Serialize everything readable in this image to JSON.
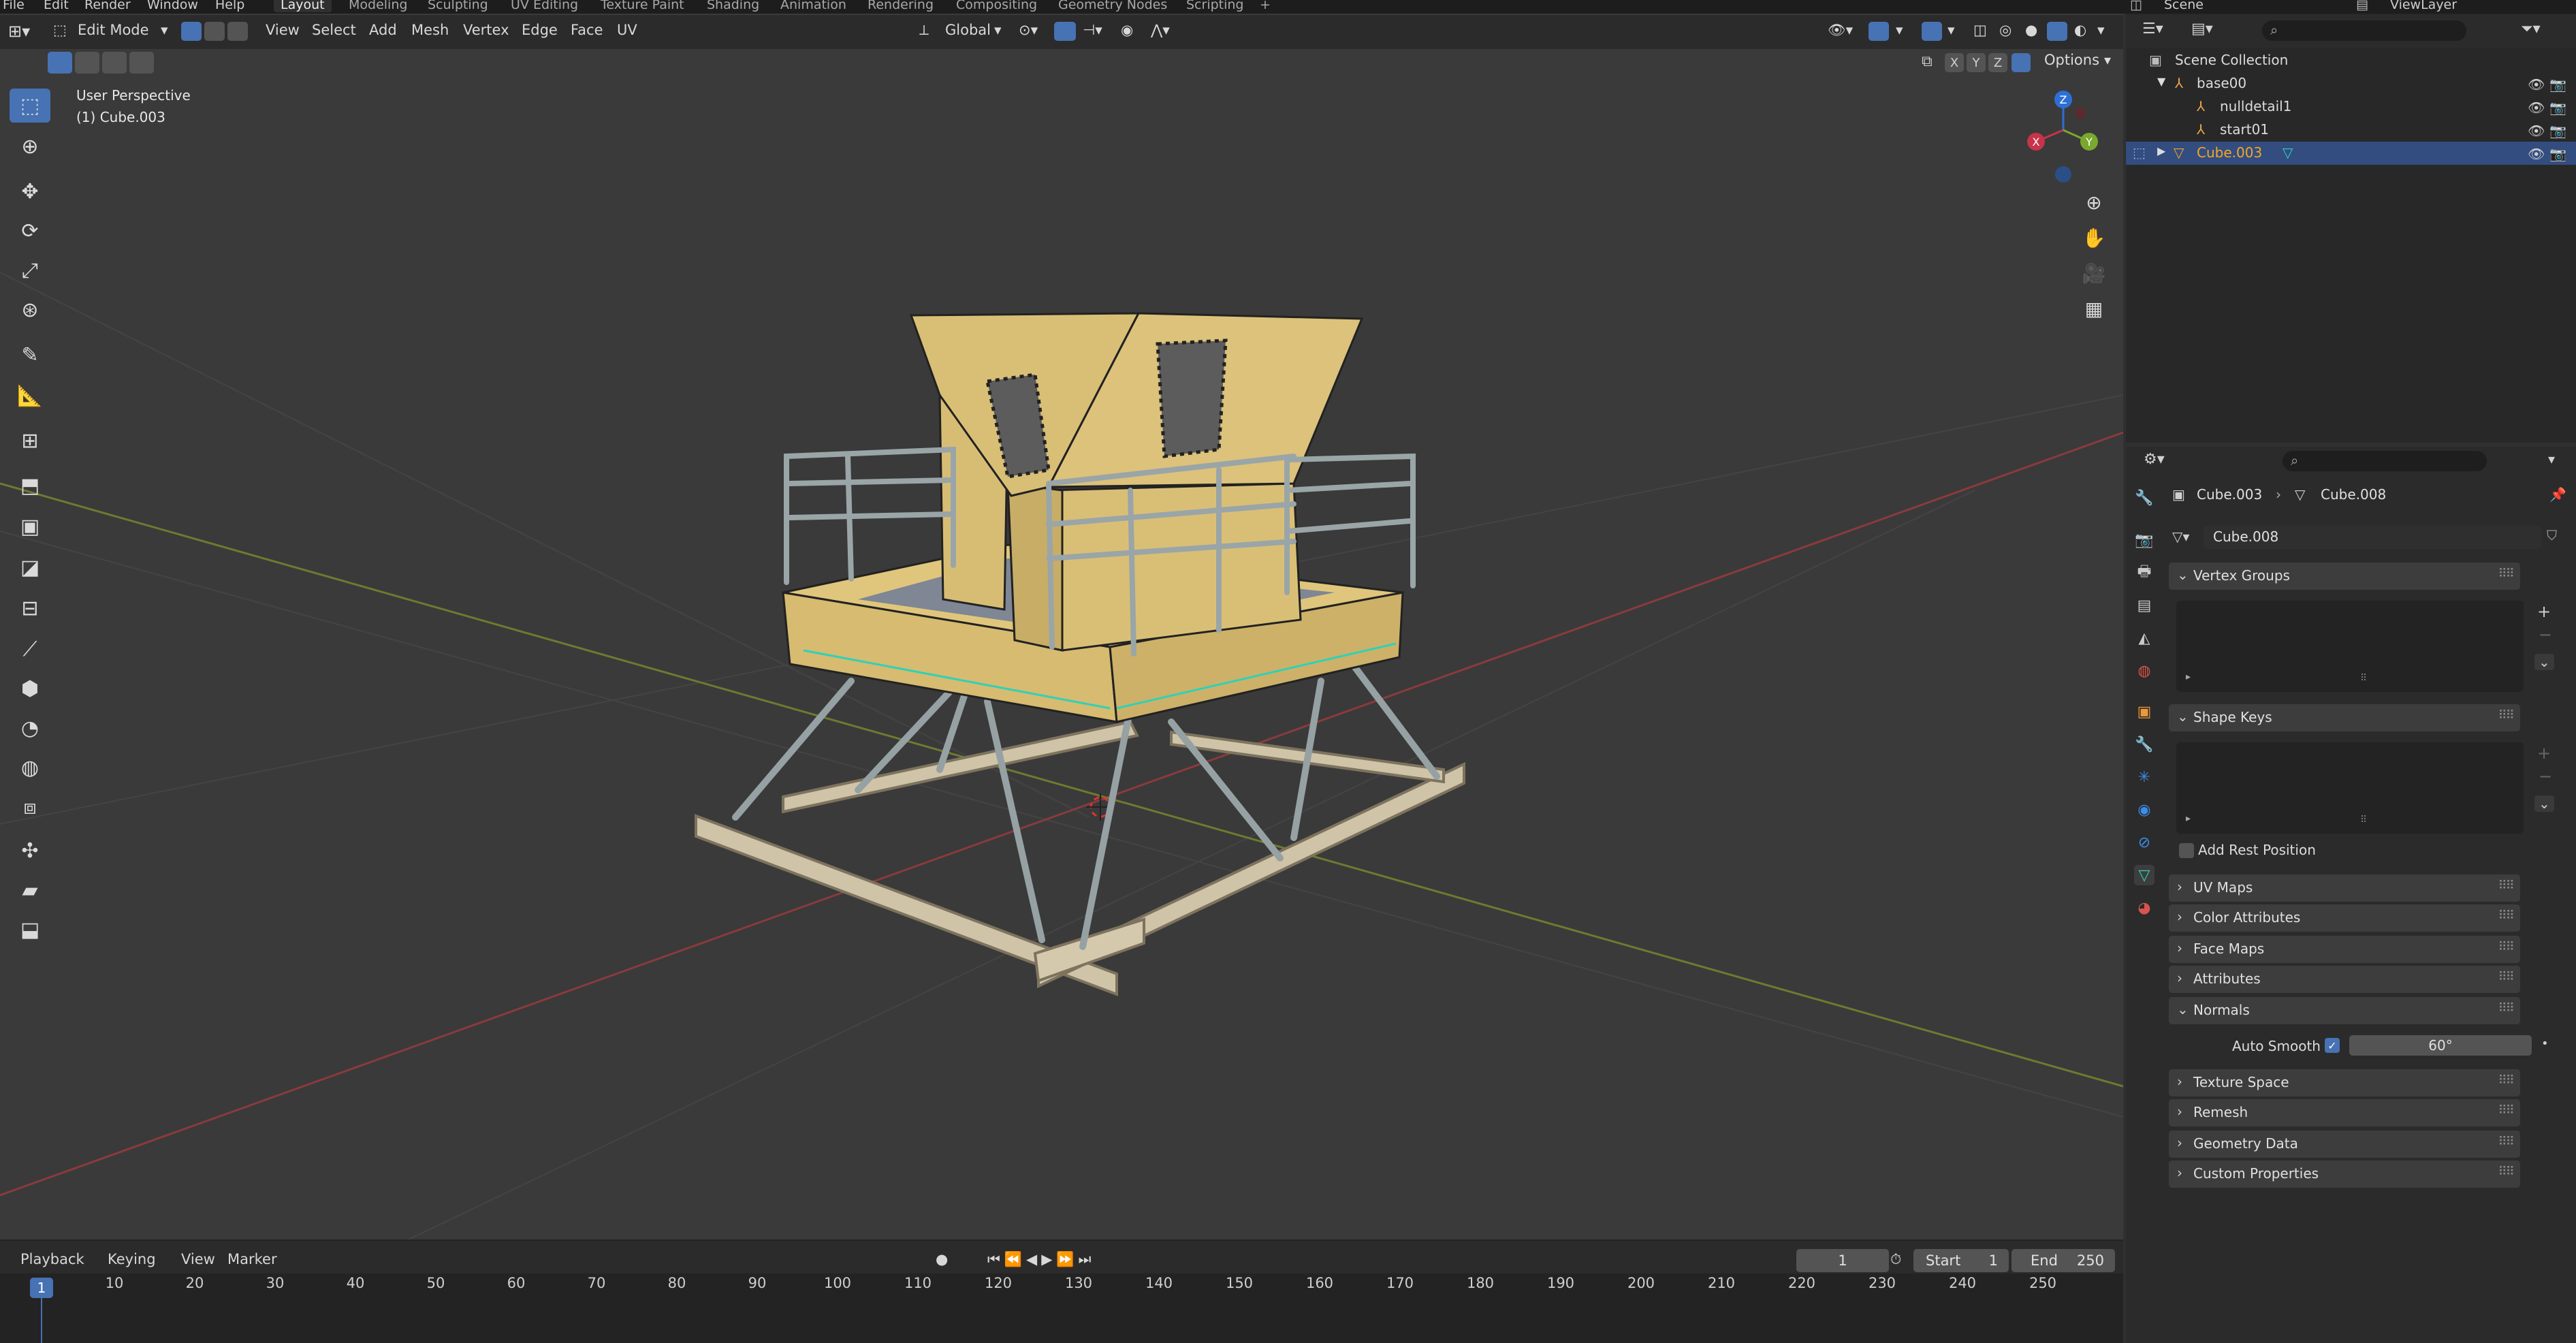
{
  "menubar": {
    "items": [
      "File",
      "Edit",
      "Render",
      "Window",
      "Help"
    ],
    "workspaces": [
      "Layout",
      "Modeling",
      "Sculpting",
      "UV Editing",
      "Texture Paint",
      "Shading",
      "Animation",
      "Rendering",
      "Compositing",
      "Geometry Nodes",
      "Scripting"
    ],
    "active_workspace": "Layout",
    "add_tab_label": "+",
    "scene": "Scene",
    "view_layer": "ViewLayer"
  },
  "viewport_header": {
    "mode": "Edit Mode",
    "menus": [
      "View",
      "Select",
      "Add",
      "Mesh",
      "Vertex",
      "Edge",
      "Face",
      "UV"
    ],
    "orientation": "Global",
    "axes": [
      "X",
      "Y",
      "Z"
    ],
    "options_label": "Options"
  },
  "viewport": {
    "perspective": "User Perspective",
    "object_label": "(1) Cube.003",
    "gizmo": {
      "z": "Z",
      "x": "X",
      "y": "Y"
    }
  },
  "toolbar_icons": [
    "select-box-icon",
    "cursor-icon",
    "move-icon",
    "rotate-icon",
    "scale-icon",
    "transform-icon",
    "annotate-icon",
    "measure-icon",
    "add-cube-icon",
    "extrude-icon",
    "inset-icon",
    "bevel-icon",
    "loop-cut-icon",
    "knife-icon",
    "poly-build-icon",
    "spin-icon",
    "smooth-icon",
    "edge-slide-icon",
    "shrink-fatten-icon",
    "shear-icon",
    "rip-icon"
  ],
  "timeline": {
    "menus": [
      "Playback",
      "Keying",
      "View",
      "Marker"
    ],
    "current_frame": "1",
    "start_label": "Start",
    "start_value": "1",
    "end_label": "End",
    "end_value": "250",
    "ruler": [
      "1",
      "10",
      "20",
      "30",
      "40",
      "50",
      "60",
      "70",
      "80",
      "90",
      "100",
      "110",
      "120",
      "130",
      "140",
      "150",
      "160",
      "170",
      "180",
      "190",
      "200",
      "210",
      "220",
      "230",
      "240",
      "250"
    ]
  },
  "outliner": {
    "items": [
      {
        "label": "Scene Collection",
        "level": 0
      },
      {
        "label": "base00",
        "level": 1
      },
      {
        "label": "nulldetail1",
        "level": 2
      },
      {
        "label": "start01",
        "level": 2
      },
      {
        "label": "Cube.003",
        "level": 1,
        "selected": true
      }
    ]
  },
  "properties": {
    "breadcrumb_object": "Cube.003",
    "breadcrumb_mesh": "Cube.008",
    "mesh_name": "Cube.008",
    "panels": {
      "vertex_groups": "Vertex Groups",
      "shape_keys": "Shape Keys",
      "add_rest_position": "Add Rest Position",
      "uv_maps": "UV Maps",
      "color_attributes": "Color Attributes",
      "face_maps": "Face Maps",
      "attributes": "Attributes",
      "normals": "Normals",
      "auto_smooth_label": "Auto Smooth",
      "auto_smooth_angle": "60°",
      "texture_space": "Texture Space",
      "remesh": "Remesh",
      "geometry_data": "Geometry Data",
      "custom_properties": "Custom Properties"
    }
  },
  "colors": {
    "accent": "#4772b3",
    "panel_bg": "#2b2b2b",
    "viewport_bg": "#3a3a3a",
    "selected_object": "#f5a623",
    "model_wood": "#d7bd74",
    "model_metal": "#9aa5a8"
  }
}
